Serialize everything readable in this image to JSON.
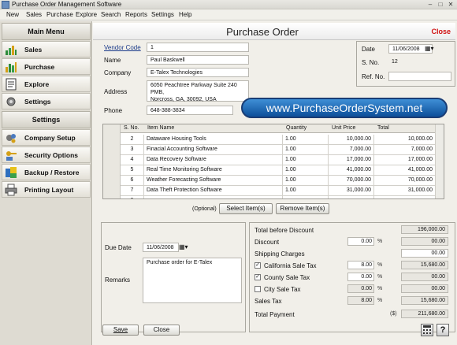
{
  "window": {
    "title": "Purchase Order Management Software"
  },
  "menu": [
    "New",
    "Sales",
    "Purchase",
    "Explore",
    "Search",
    "Reports",
    "Settings",
    "Help"
  ],
  "sidebar": {
    "main_menu_title": "Main Menu",
    "main_items": [
      {
        "label": "Sales",
        "icon": "sales-icon"
      },
      {
        "label": "Purchase",
        "icon": "purchase-icon"
      },
      {
        "label": "Explore",
        "icon": "explore-icon"
      },
      {
        "label": "Settings",
        "icon": "settings-icon"
      }
    ],
    "settings_title": "Settings",
    "settings_items": [
      {
        "label": "Company Setup",
        "icon": "company-setup-icon"
      },
      {
        "label": "Security Options",
        "icon": "security-icon"
      },
      {
        "label": "Backup / Restore",
        "icon": "backup-icon"
      },
      {
        "label": "Printing Layout",
        "icon": "printer-icon"
      }
    ]
  },
  "form": {
    "title": "Purchase Order",
    "close_label": "Close",
    "vendor_code_label": "Vendor Code",
    "vendor_code": "1",
    "name_label": "Name",
    "name": "Paul Baskwell",
    "company_label": "Company",
    "company": "E-Talex Technologies",
    "address_label": "Address",
    "address": "6050 Peachtree Parkway Suite 240 PMB,\nNorcross, GA, 30092, USA",
    "phone_label": "Phone",
    "phone": "648-388-3834",
    "date_label": "Date",
    "date": "11/06/2008",
    "sno_label": "S. No.",
    "sno": "12",
    "ref_label": "Ref. No.",
    "ref": ""
  },
  "banner": "www.PurchaseOrderSystem.net",
  "table": {
    "columns": [
      "S. No.",
      "Item Name",
      "Quantity",
      "Unit Price",
      "Total"
    ],
    "rows": [
      [
        "2",
        "Dataware Housing Tools",
        "1.00",
        "10,000.00",
        "10,000.00"
      ],
      [
        "3",
        "Finacial Accounting Software",
        "1.00",
        "7,000.00",
        "7,000.00"
      ],
      [
        "4",
        "Data Recovery Software",
        "1.00",
        "17,000.00",
        "17,000.00"
      ],
      [
        "5",
        "Real Time Monitoring Software",
        "1.00",
        "41,000.00",
        "41,000.00"
      ],
      [
        "6",
        "Weather Forecasting Software",
        "1.00",
        "70,000.00",
        "70,000.00"
      ],
      [
        "7",
        "Data Theft Protection Software",
        "1.00",
        "31,000.00",
        "31,000.00"
      ],
      [
        "8",
        "",
        "",
        "",
        ""
      ]
    ]
  },
  "item_actions": {
    "optional_label": "(Optional)",
    "select_label": "Select Item(s)",
    "remove_label": "Remove Item(s)"
  },
  "bottom": {
    "due_date_label": "Due Date",
    "due_date": "11/06/2008",
    "remarks_label": "Remarks",
    "remarks": "Purchase order for E-Talex"
  },
  "totals": {
    "total_before_discount_label": "Total before Discount",
    "total_before_discount": "196,000.00",
    "discount_label": "Discount",
    "discount_pct": "0.00",
    "discount_amt": "00.00",
    "shipping_label": "Shipping Charges",
    "shipping": "00.00",
    "california_label": "California Sale Tax",
    "california_checked": true,
    "california_pct": "8.00",
    "california_amt": "15,680.00",
    "county_label": "County Sale Tax",
    "county_checked": true,
    "county_pct": "0.00",
    "county_amt": "00.00",
    "city_label": "City Sale Tax",
    "city_checked": false,
    "city_pct": "0.00",
    "city_amt": "00.00",
    "sales_tax_label": "Sales Tax",
    "sales_tax_pct": "8.00",
    "sales_tax_amt": "15,680.00",
    "total_payment_label": "Total Payment",
    "currency": "($)",
    "total_payment": "211,680.00",
    "pct_sign": "%"
  },
  "footer": {
    "save_label": "Save",
    "close_label": "Close"
  }
}
